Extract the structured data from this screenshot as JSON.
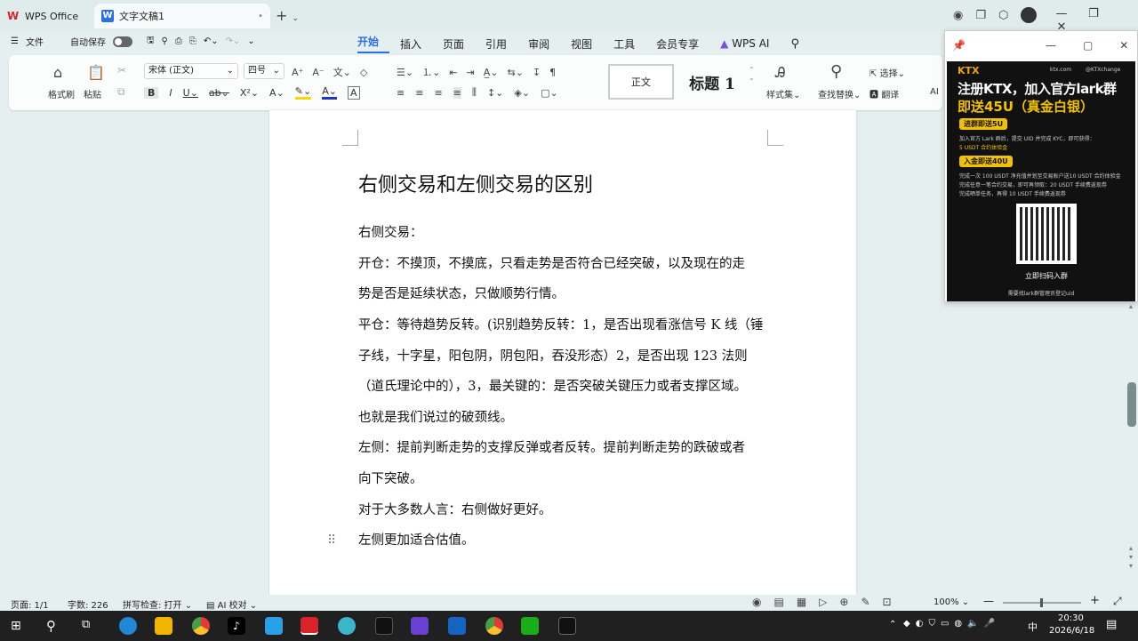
{
  "titlebar": {
    "app_tab": "WPS Office",
    "doc_tab": "文字文稿1",
    "doc_tab_close": "•",
    "new_tab": "+"
  },
  "menubar": {
    "file": "文件",
    "autosave": "自动保存",
    "tabs": [
      "开始",
      "插入",
      "页面",
      "引用",
      "审阅",
      "视图",
      "工具",
      "会员专享"
    ],
    "wps_ai": "WPS AI"
  },
  "ribbon": {
    "format_painter": "格式刷",
    "paste": "粘贴",
    "font_name": "宋体 (正文)",
    "font_size": "四号",
    "style_normal": "正文",
    "style_heading": "标题 1",
    "style_set": "样式集",
    "find_replace": "查找替换",
    "select": "选择",
    "translate": "翻译",
    "ai_label": "AI"
  },
  "document": {
    "title": "右侧交易和左侧交易的区别",
    "paragraphs": [
      "右侧交易：",
      "开仓：不摸顶，不摸底，只看走势是否符合已经突破，以及现在的走",
      "势是否是延续状态，只做顺势行情。",
      "平仓：等待趋势反转。(识别趋势反转：1，是否出现看涨信号 K 线（锤",
      "子线，十字星，阳包阴，阴包阳，吞没形态）2，是否出现 123 法则",
      "（道氏理论中的），3，最关键的：是否突破关键压力或者支撑区域。",
      "也就是我们说过的破颈线。",
      "左侧：提前判断走势的支撑反弹或者反转。提前判断走势的跌破或者",
      "向下突破。",
      "对于大多数人言：右侧做好更好。",
      "左侧更加适合估值。"
    ]
  },
  "ad": {
    "brand": "KTX",
    "site": "ktx.com",
    "handle": "@KTXchange",
    "headline1": "注册KTX，加入官方lark群",
    "headline2": "即送45U（真金白银）",
    "tag1": "进群即送5U",
    "line1": "加入官方 Lark 群后，提交 UID 并完成 KYC，即可获得：",
    "line2": "5 USDT 合约体验金",
    "tag2": "入金即送40U",
    "line3": "完成一次 100 USDT 净充值并划至交易账户送10 USDT 合约体验金",
    "line4": "完成任意一笔合约交易，即可再领取：20 USDT 手续费返现券",
    "line5": "完成晒单任务，再得 10 USDT 手续费返现券",
    "scan": "立即扫码入群",
    "footer": "需要找lark群管理员登记uid"
  },
  "status": {
    "page": "页面: 1/1",
    "words": "字数: 226",
    "spell": "拼写检查: 打开",
    "ai_proof": "AI 校对",
    "zoom": "100%"
  },
  "taskbar": {
    "time": "20:30",
    "date": "2026/6/18",
    "ime": "中"
  }
}
